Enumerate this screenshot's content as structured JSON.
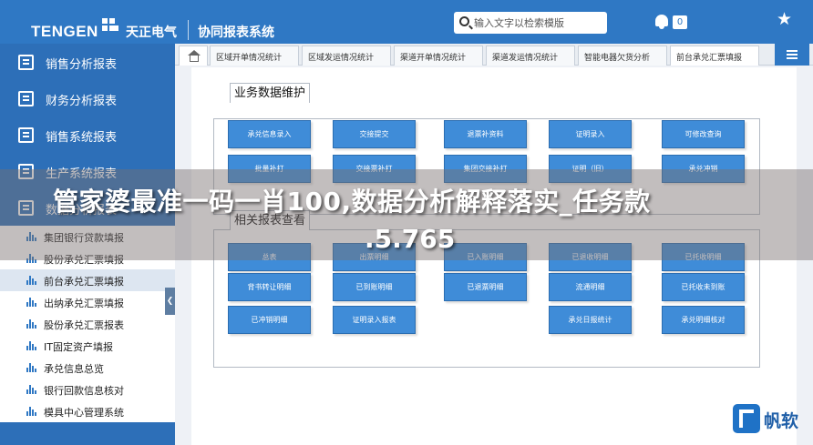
{
  "header": {
    "logo_text": "TENGEN",
    "logo_cn": "天正电气",
    "system_title": "协同报表系统",
    "search_placeholder": "输入文字以检索模版",
    "notification_count": "0"
  },
  "sidebar": {
    "menus": [
      {
        "label": "销售分析报表"
      },
      {
        "label": "财务分析报表"
      },
      {
        "label": "销售系统报表"
      },
      {
        "label": "生产系统报表"
      },
      {
        "label": "数据分析报表"
      }
    ],
    "sub_items": [
      {
        "label": "集团银行贷款填报"
      },
      {
        "label": "股份承兑汇票填报"
      },
      {
        "label": "前台承兑汇票填报",
        "active": true
      },
      {
        "label": "出纳承兑汇票填报"
      },
      {
        "label": "股份承兑汇票报表"
      },
      {
        "label": "IT固定资产填报"
      },
      {
        "label": "承兑信息总览"
      },
      {
        "label": "银行回款信息核对"
      },
      {
        "label": "模具中心管理系统"
      }
    ]
  },
  "tabs": [
    "区域开单情况统计",
    "区域发运情况统计",
    "渠道开单情况统计",
    "渠道发运情况统计",
    "智能电器欠货分析",
    "前台承兑汇票填报"
  ],
  "sections": {
    "maintain": {
      "title": "业务数据维护",
      "buttons": [
        "承兑信息录入",
        "交接提交",
        "退票补资料",
        "证明录入",
        "可修改查询",
        "批量补打",
        "交接票补打",
        "集团交接补打",
        "证明（旧）",
        "承兑冲销"
      ]
    },
    "query": {
      "title": "相关报表查看",
      "buttons": [
        "总表",
        "出票明细",
        "已入账明细",
        "已退收明细",
        "已托收明细",
        "背书转让明细",
        "已到账明细",
        "已退票明细",
        "流通明细",
        "已托收未到账",
        "已冲销明细",
        "证明录入报表",
        "承兑日报统计",
        "承兑明细核对"
      ]
    }
  },
  "overlay": {
    "line1": "管家婆最准一码一肖100,数据分析解释落实_任务款",
    "line2": ".5.765"
  },
  "watermark": {
    "text": "帆软"
  }
}
